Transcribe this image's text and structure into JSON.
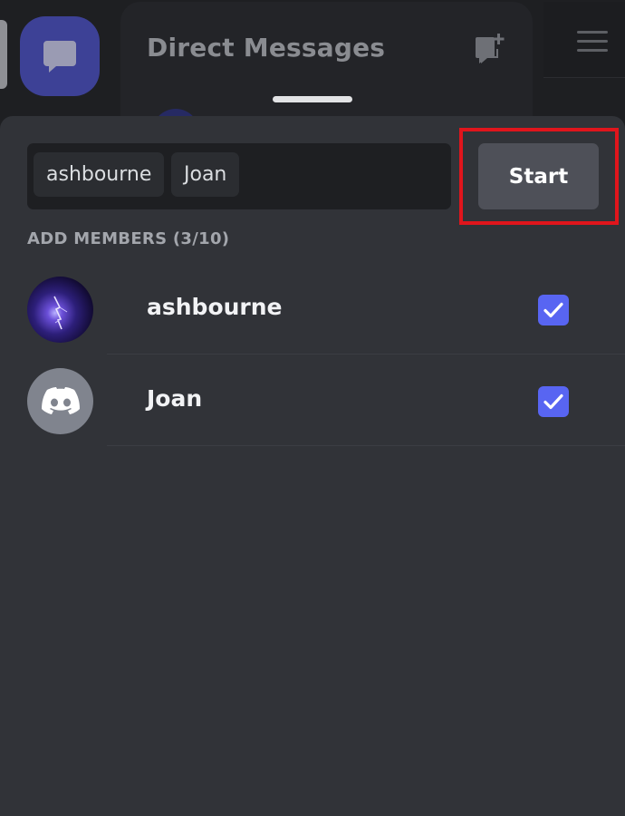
{
  "background": {
    "title": "Direct Messages"
  },
  "search": {
    "selected": [
      "ashbourne",
      "Joan"
    ]
  },
  "start_button": {
    "label": "Start"
  },
  "members": {
    "header": "ADD MEMBERS (3/10)",
    "items": [
      {
        "name": "ashbourne",
        "avatar": "storm-avatar",
        "checked": true
      },
      {
        "name": "Joan",
        "avatar": "discord-default-avatar",
        "checked": true
      }
    ]
  },
  "colors": {
    "accent": "#5865f2",
    "highlight": "#e0151c",
    "sheet": "#313338"
  },
  "icons": {
    "dm": "chat-bubble-icon",
    "new_dm": "new-message-icon",
    "menu": "hamburger-menu-icon",
    "check": "checkmark-icon"
  }
}
